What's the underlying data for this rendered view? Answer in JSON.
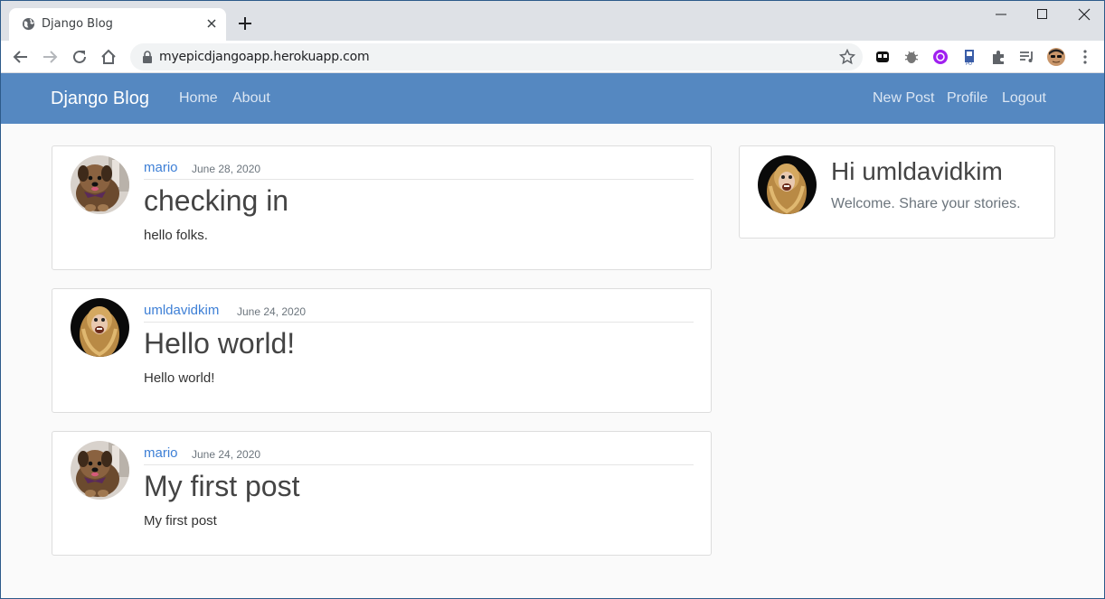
{
  "browser": {
    "tab_title": "Django Blog",
    "url": "myepicdjangoapp.herokuapp.com",
    "icons": [
      "globe-icon",
      "close-icon",
      "plus-icon",
      "minimize-icon",
      "maximize-icon",
      "back-icon",
      "forward-icon",
      "reload-icon",
      "home-icon",
      "lock-icon",
      "star-icon",
      "extensions-icon",
      "menu-icon"
    ]
  },
  "navbar": {
    "brand": "Django Blog",
    "left_links": [
      "Home",
      "About"
    ],
    "right_links": [
      "New Post",
      "Profile",
      "Logout"
    ],
    "color": "#5588c1"
  },
  "posts": [
    {
      "author": "mario",
      "date": "June 28, 2020",
      "title": "checking in",
      "content": "hello folks.",
      "avatar": "dog-avatar"
    },
    {
      "author": "umldavidkim",
      "date": "June 24, 2020",
      "title": "Hello world!",
      "content": "Hello world!",
      "avatar": "monkey-avatar"
    },
    {
      "author": "mario",
      "date": "June 24, 2020",
      "title": "My first post",
      "content": "My first post",
      "avatar": "dog-avatar"
    }
  ],
  "sidebar": {
    "greeting": "Hi umldavidkim",
    "subtitle": "Welcome. Share your stories."
  }
}
